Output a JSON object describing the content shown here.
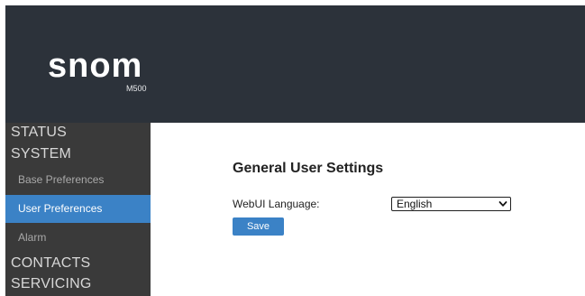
{
  "header": {
    "logo_text": "snom",
    "model": "M500",
    "background_color": "#2c323a"
  },
  "sidebar": {
    "background_color": "#3a3a3a",
    "active_color": "#3b82c6",
    "sections": [
      {
        "label": "STATUS"
      },
      {
        "label": "SYSTEM",
        "items": [
          {
            "label": "Base Preferences",
            "active": false
          },
          {
            "label": "User Preferences",
            "active": true
          },
          {
            "label": "Alarm",
            "active": false
          }
        ]
      },
      {
        "label": "CONTACTS"
      },
      {
        "label": "SERVICING"
      }
    ]
  },
  "main": {
    "title": "General User Settings",
    "fields": [
      {
        "label": "WebUI Language:",
        "value": "English",
        "icon": "chevron-down-icon"
      }
    ],
    "save_label": "Save"
  }
}
